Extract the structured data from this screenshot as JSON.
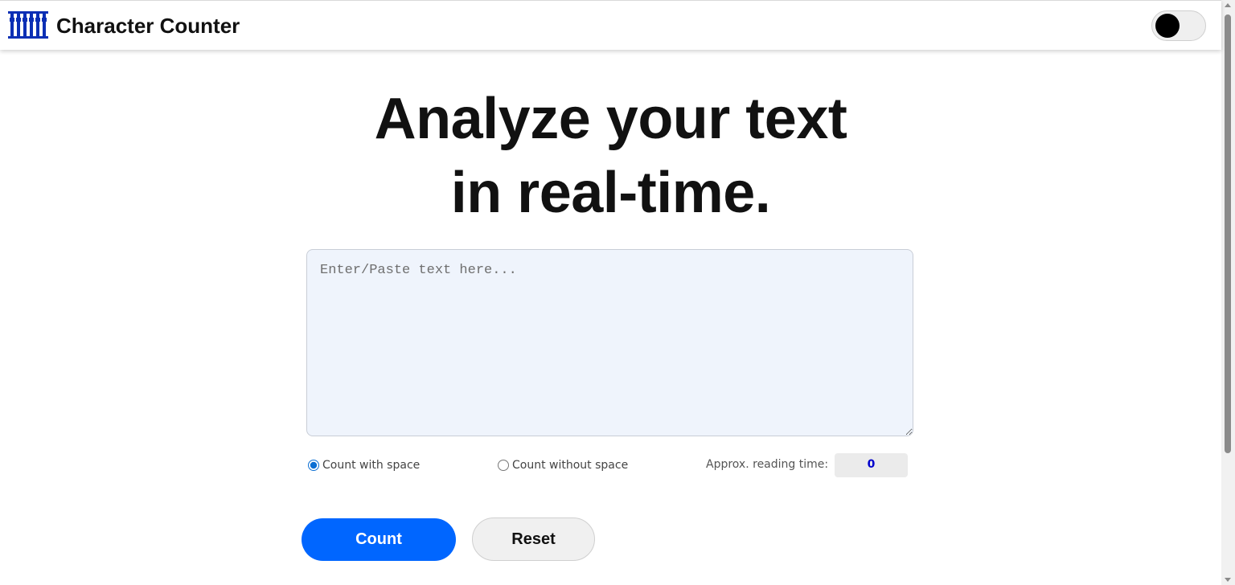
{
  "header": {
    "app_title": "Character Counter",
    "logo_icon": "abacus-icon",
    "theme_toggle_icon": "dark-mode-toggle"
  },
  "hero": {
    "line1": "Analyze your text",
    "line2": "in real-time."
  },
  "editor": {
    "placeholder": "Enter/Paste text here...",
    "value": ""
  },
  "options": {
    "count_with_space_label": "Count with space",
    "count_without_space_label": "Count without space",
    "selected": "Count with space",
    "reading_time_label": "Approx. reading time:",
    "reading_time_value": "0"
  },
  "actions": {
    "count_label": "Count",
    "reset_label": "Reset"
  },
  "colors": {
    "brand_blue": "#0066ff",
    "logo_blue": "#0b2fb5",
    "reading_value": "#0000cc",
    "editor_bg": "#eff4fc"
  }
}
